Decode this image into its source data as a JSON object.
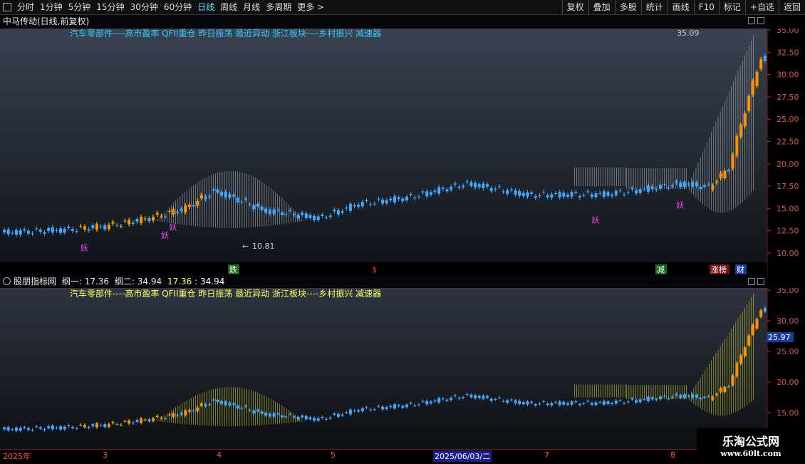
{
  "toolbar": {
    "timeframes": [
      "分时",
      "1分钟",
      "5分钟",
      "15分钟",
      "30分钟",
      "60分钟",
      "日线",
      "周线",
      "月线",
      "多周期",
      "更多 >"
    ],
    "active_index": 6,
    "right_buttons": [
      "复权",
      "叠加",
      "多股",
      "统计",
      "画线",
      "F10",
      "标记",
      "+自选",
      "返回"
    ]
  },
  "main_panel": {
    "title": "中马传动(日线,前复权)",
    "indicator_text": "汽车零部件----高市盈率 QFII重仓 昨日振荡 最近异动 浙江板块----乡村振兴 减速器",
    "high_label": "35.09",
    "low_label": "10.81",
    "yaxis": [
      "35.00",
      "32.50",
      "30.00",
      "27.50",
      "25.00",
      "22.50",
      "20.00",
      "17.50",
      "15.00",
      "12.50",
      "10.00"
    ],
    "marks": [
      "妖",
      "妖",
      "妖",
      "妖",
      "妖"
    ],
    "bottom_badges": [
      "跌",
      "$",
      "减",
      "涨榜",
      "财"
    ],
    "colors": {
      "up": "#ffff00",
      "down": "#3fa8ff",
      "envelope": "#c8c8c8",
      "magenta": "#ff40ff",
      "bg_top": "#3a4250",
      "bg_bottom": "#101318"
    }
  },
  "sub_panel": {
    "title": "股朋指标网",
    "line1_label": "纲一: 17.36",
    "line2_label": "纲二: 34.94",
    "line1_value": "17.36",
    "line2_value": "34.94",
    "indicator_text": "汽车零部件----高市盈率 QFII重仓 昨日振荡 最近异动 浙江板块----乡村振兴 减速器",
    "yaxis": [
      "35.00",
      "30.00",
      "25.00",
      "20.00",
      "15.00"
    ],
    "current_price_tag": "25.97",
    "colors": {
      "envelope": "#e8e830",
      "tag_bg": "#1a3aa0"
    }
  },
  "date_axis": {
    "labels": [
      "2025年",
      "3",
      "4",
      "5",
      "2025/06/03/二",
      "7",
      "8"
    ],
    "selected_index": 4
  },
  "watermark": {
    "line1": "乐淘公式网",
    "line2": "www.60lt.com"
  }
}
